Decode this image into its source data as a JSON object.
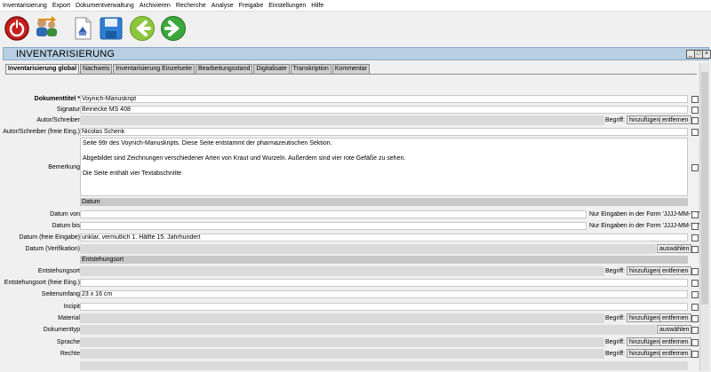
{
  "menu": [
    "Inventarisierung",
    "Export",
    "Dokumentverwaltung",
    "Archivieren",
    "Recherche",
    "Analyse",
    "Freigabe",
    "Einstellungen",
    "Hilfe"
  ],
  "window": {
    "title": "INVENTARISIERUNG"
  },
  "tabs": [
    "Inventarisierung global",
    "Nachweis",
    "Inventarisierung Einzelseite",
    "Bearbeitungsstand",
    "Digitalisate",
    "Transkription",
    "Kommentar"
  ],
  "fields": {
    "dokumenttitel": {
      "label": "Dokumenttitel *",
      "value": "Voynich-Manuskript"
    },
    "signatur": {
      "label": "Signatur",
      "value": "Beinecke MS 408"
    },
    "autor": {
      "label": "Autor/Schreiber"
    },
    "autor_frei": {
      "label": "Autor/Schreiber (freie Eing.)",
      "value": "Nicolas Schenk"
    },
    "bemerkung": {
      "label": "Bemerkung",
      "lines": [
        "Seite 99r des Voynich-Manuskripts. Diese Seite entstammt der pharmazeutischen Sektion.",
        "Abgebildet sind Zeichnungen verschiedener Arten von Kraut und Wurzeln. Außerdem sind vier rote Gefäße zu sehen.",
        "Die Seite enthält vier Textabschnitte"
      ]
    },
    "datum_von": {
      "label": "Datum von"
    },
    "datum_bis": {
      "label": "Datum bis"
    },
    "datum_frei": {
      "label": "Datum (freie Eingabe)",
      "value": "unklar, vermutlich 1. Hälfte 15. Jahrhundert"
    },
    "datum_verif": {
      "label": "Datum (Verifikation)"
    },
    "entstehungsort": {
      "label": "Entstehungsort"
    },
    "entstehungsort_frei": {
      "label": "Entstehungsort (freie Eing.)"
    },
    "seitenumfang": {
      "label": "Seitenumfang",
      "value": "23 x 16 cm"
    },
    "incipit": {
      "label": "Incipit"
    },
    "material": {
      "label": "Material"
    },
    "dokumenttyp": {
      "label": "Dokumenttyp"
    },
    "sprache": {
      "label": "Sprache"
    },
    "rechte": {
      "label": "Rechte"
    }
  },
  "sections": {
    "datum": "Datum",
    "entstehung": "Entstehungsort"
  },
  "common": {
    "begriff": "Begriff:",
    "hinzufuegen": "hinzufügen",
    "entfernen": "entfernen",
    "auswaehlen": "auswählen",
    "hint": "Nur Eingaben in der Form 'JJJJ-MM-TT'"
  }
}
